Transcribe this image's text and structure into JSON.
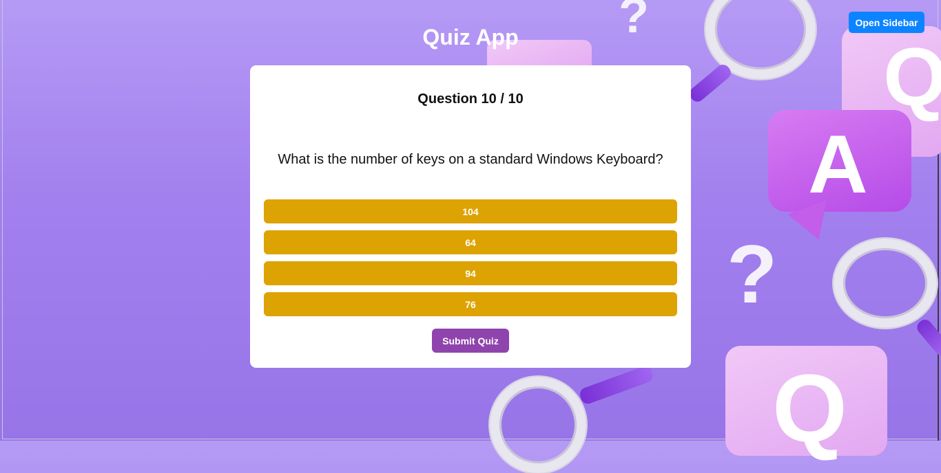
{
  "app": {
    "title": "Quiz App"
  },
  "header": {
    "sidebar_button_label": "Open Sidebar"
  },
  "quiz": {
    "progress_label": "Question 10 / 10",
    "question": "What is the number of keys on a standard Windows Keyboard?",
    "options": [
      "104",
      "64",
      "94",
      "76"
    ],
    "submit_label": "Submit Quiz"
  },
  "background": {
    "tile_letters": [
      "Q",
      "A",
      "Q"
    ],
    "question_mark": "?"
  },
  "colors": {
    "accent_blue": "#0d84ff",
    "option_gold": "#dda303",
    "submit_purple": "#8f44ad",
    "background_purple": "#a280ee"
  }
}
